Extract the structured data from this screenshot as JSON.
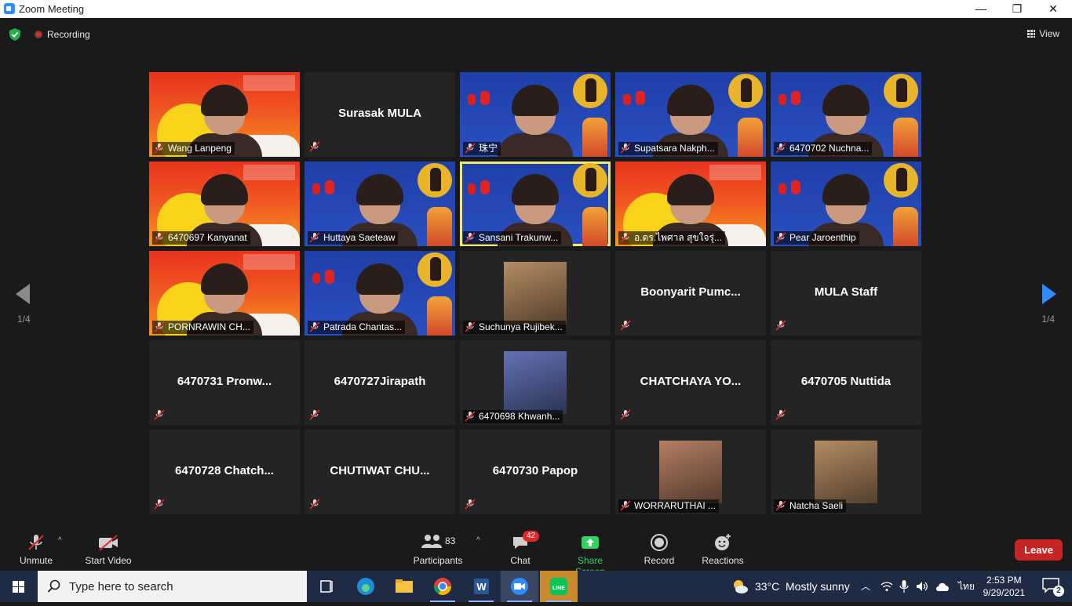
{
  "window": {
    "title": "Zoom Meeting",
    "minimize": "—",
    "restore": "❐",
    "close": "✕"
  },
  "meeting": {
    "recording_label": "Recording",
    "view_label": "View"
  },
  "pagination": {
    "left_page": "1/4",
    "right_page": "1/4"
  },
  "tiles": [
    {
      "name": "Wang Lanpeng",
      "type": "video",
      "bg": "red"
    },
    {
      "name": "Surasak MULA",
      "type": "name"
    },
    {
      "name": "珠宁",
      "type": "video",
      "bg": "blue"
    },
    {
      "name": "Supatsara Nakph...",
      "type": "video",
      "bg": "blue"
    },
    {
      "name": "6470702 Nuchna...",
      "type": "video",
      "bg": "blue"
    },
    {
      "name": "6470697 Kanyanat",
      "type": "video",
      "bg": "red"
    },
    {
      "name": "Huttaya Saeteaw",
      "type": "video",
      "bg": "blue"
    },
    {
      "name": "Sansani Trakunw...",
      "type": "video",
      "bg": "blue",
      "active": true
    },
    {
      "name": "อ.ดร.ไพศาล  สุขใจรุ่...",
      "type": "video",
      "bg": "red"
    },
    {
      "name": "Pear Jaroenthip",
      "type": "video",
      "bg": "blue"
    },
    {
      "name": "PORNRAWIN CH...",
      "type": "video",
      "bg": "red"
    },
    {
      "name": "Patrada Chantas...",
      "type": "video",
      "bg": "blue"
    },
    {
      "name": "Suchunya Rujibek...",
      "type": "photo"
    },
    {
      "name": "Boonyarit  Pumc...",
      "type": "name"
    },
    {
      "name": "MULA Staff",
      "type": "name"
    },
    {
      "name": "6470731 Pronw...",
      "type": "name"
    },
    {
      "name": "6470727Jirapath",
      "type": "name"
    },
    {
      "name": "6470698 Khwanh...",
      "type": "photo"
    },
    {
      "name": "CHATCHAYA  YO...",
      "type": "name"
    },
    {
      "name": "6470705 Nuttida",
      "type": "name"
    },
    {
      "name": "6470728 Chatch...",
      "type": "name"
    },
    {
      "name": "CHUTIWAT  CHU...",
      "type": "name"
    },
    {
      "name": "6470730 Papop",
      "type": "name"
    },
    {
      "name": "WORRARUTHAI ...",
      "type": "photo"
    },
    {
      "name": "Natcha Saeli",
      "type": "photo"
    }
  ],
  "toolbar": {
    "unmute": "Unmute",
    "start_video": "Start Video",
    "participants": "Participants",
    "participants_count": "83",
    "chat": "Chat",
    "chat_badge": "42",
    "share_screen": "Share Screen",
    "record": "Record",
    "reactions": "Reactions",
    "leave": "Leave"
  },
  "taskbar": {
    "search_placeholder": "Type here to search",
    "weather_temp": "33°C",
    "weather_desc": "Mostly sunny",
    "lang": "ไทย",
    "time": "2:53 PM",
    "date": "9/29/2021",
    "notifications": "2"
  },
  "colors": {
    "accent": "#2d8cff",
    "share_green": "#2fd15f",
    "leave_red": "#c72525",
    "active_speaker": "#f2ea6a"
  }
}
